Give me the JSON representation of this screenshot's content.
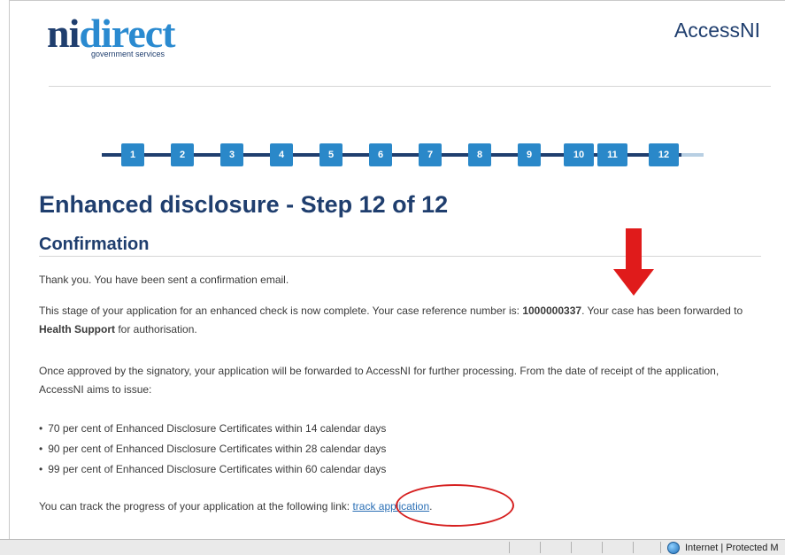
{
  "header": {
    "logo_ni": "ni",
    "logo_direct": "direct",
    "logo_sub": "government services",
    "site_name": "AccessNI"
  },
  "stepper": {
    "steps": [
      "1",
      "2",
      "3",
      "4",
      "5",
      "6",
      "7",
      "8",
      "9",
      "10",
      "11",
      "12"
    ],
    "current": 12
  },
  "page": {
    "title": "Enhanced disclosure - Step 12 of 12",
    "subtitle": "Confirmation"
  },
  "content": {
    "p1": "Thank you. You have been sent a confirmation email.",
    "p2_a": "This stage of your application for an enhanced check is now complete. Your case reference number is: ",
    "p2_ref": "1000000337",
    "p2_b": ". Your case has been forwarded to ",
    "p2_org": "Health Support",
    "p2_c": " for authorisation.",
    "p3": "Once approved by the signatory, your application will be forwarded to AccessNI for further processing. From the date of receipt of the application, AccessNI aims to issue:",
    "targets": [
      "70 per cent of Enhanced Disclosure Certificates within 14 calendar days",
      "90 per cent of Enhanced Disclosure Certificates within 28 calendar days",
      "99 per cent of Enhanced Disclosure Certificates within 60 calendar days"
    ],
    "p4_text": "You can track the progress of your application at the following link: ",
    "p4_link": "track application",
    "p4_end": "."
  },
  "annotations": {
    "arrow_color": "#e01b1b",
    "ellipse_color": "#d62020"
  },
  "statusbar": {
    "zone": "Internet | Protected M"
  }
}
